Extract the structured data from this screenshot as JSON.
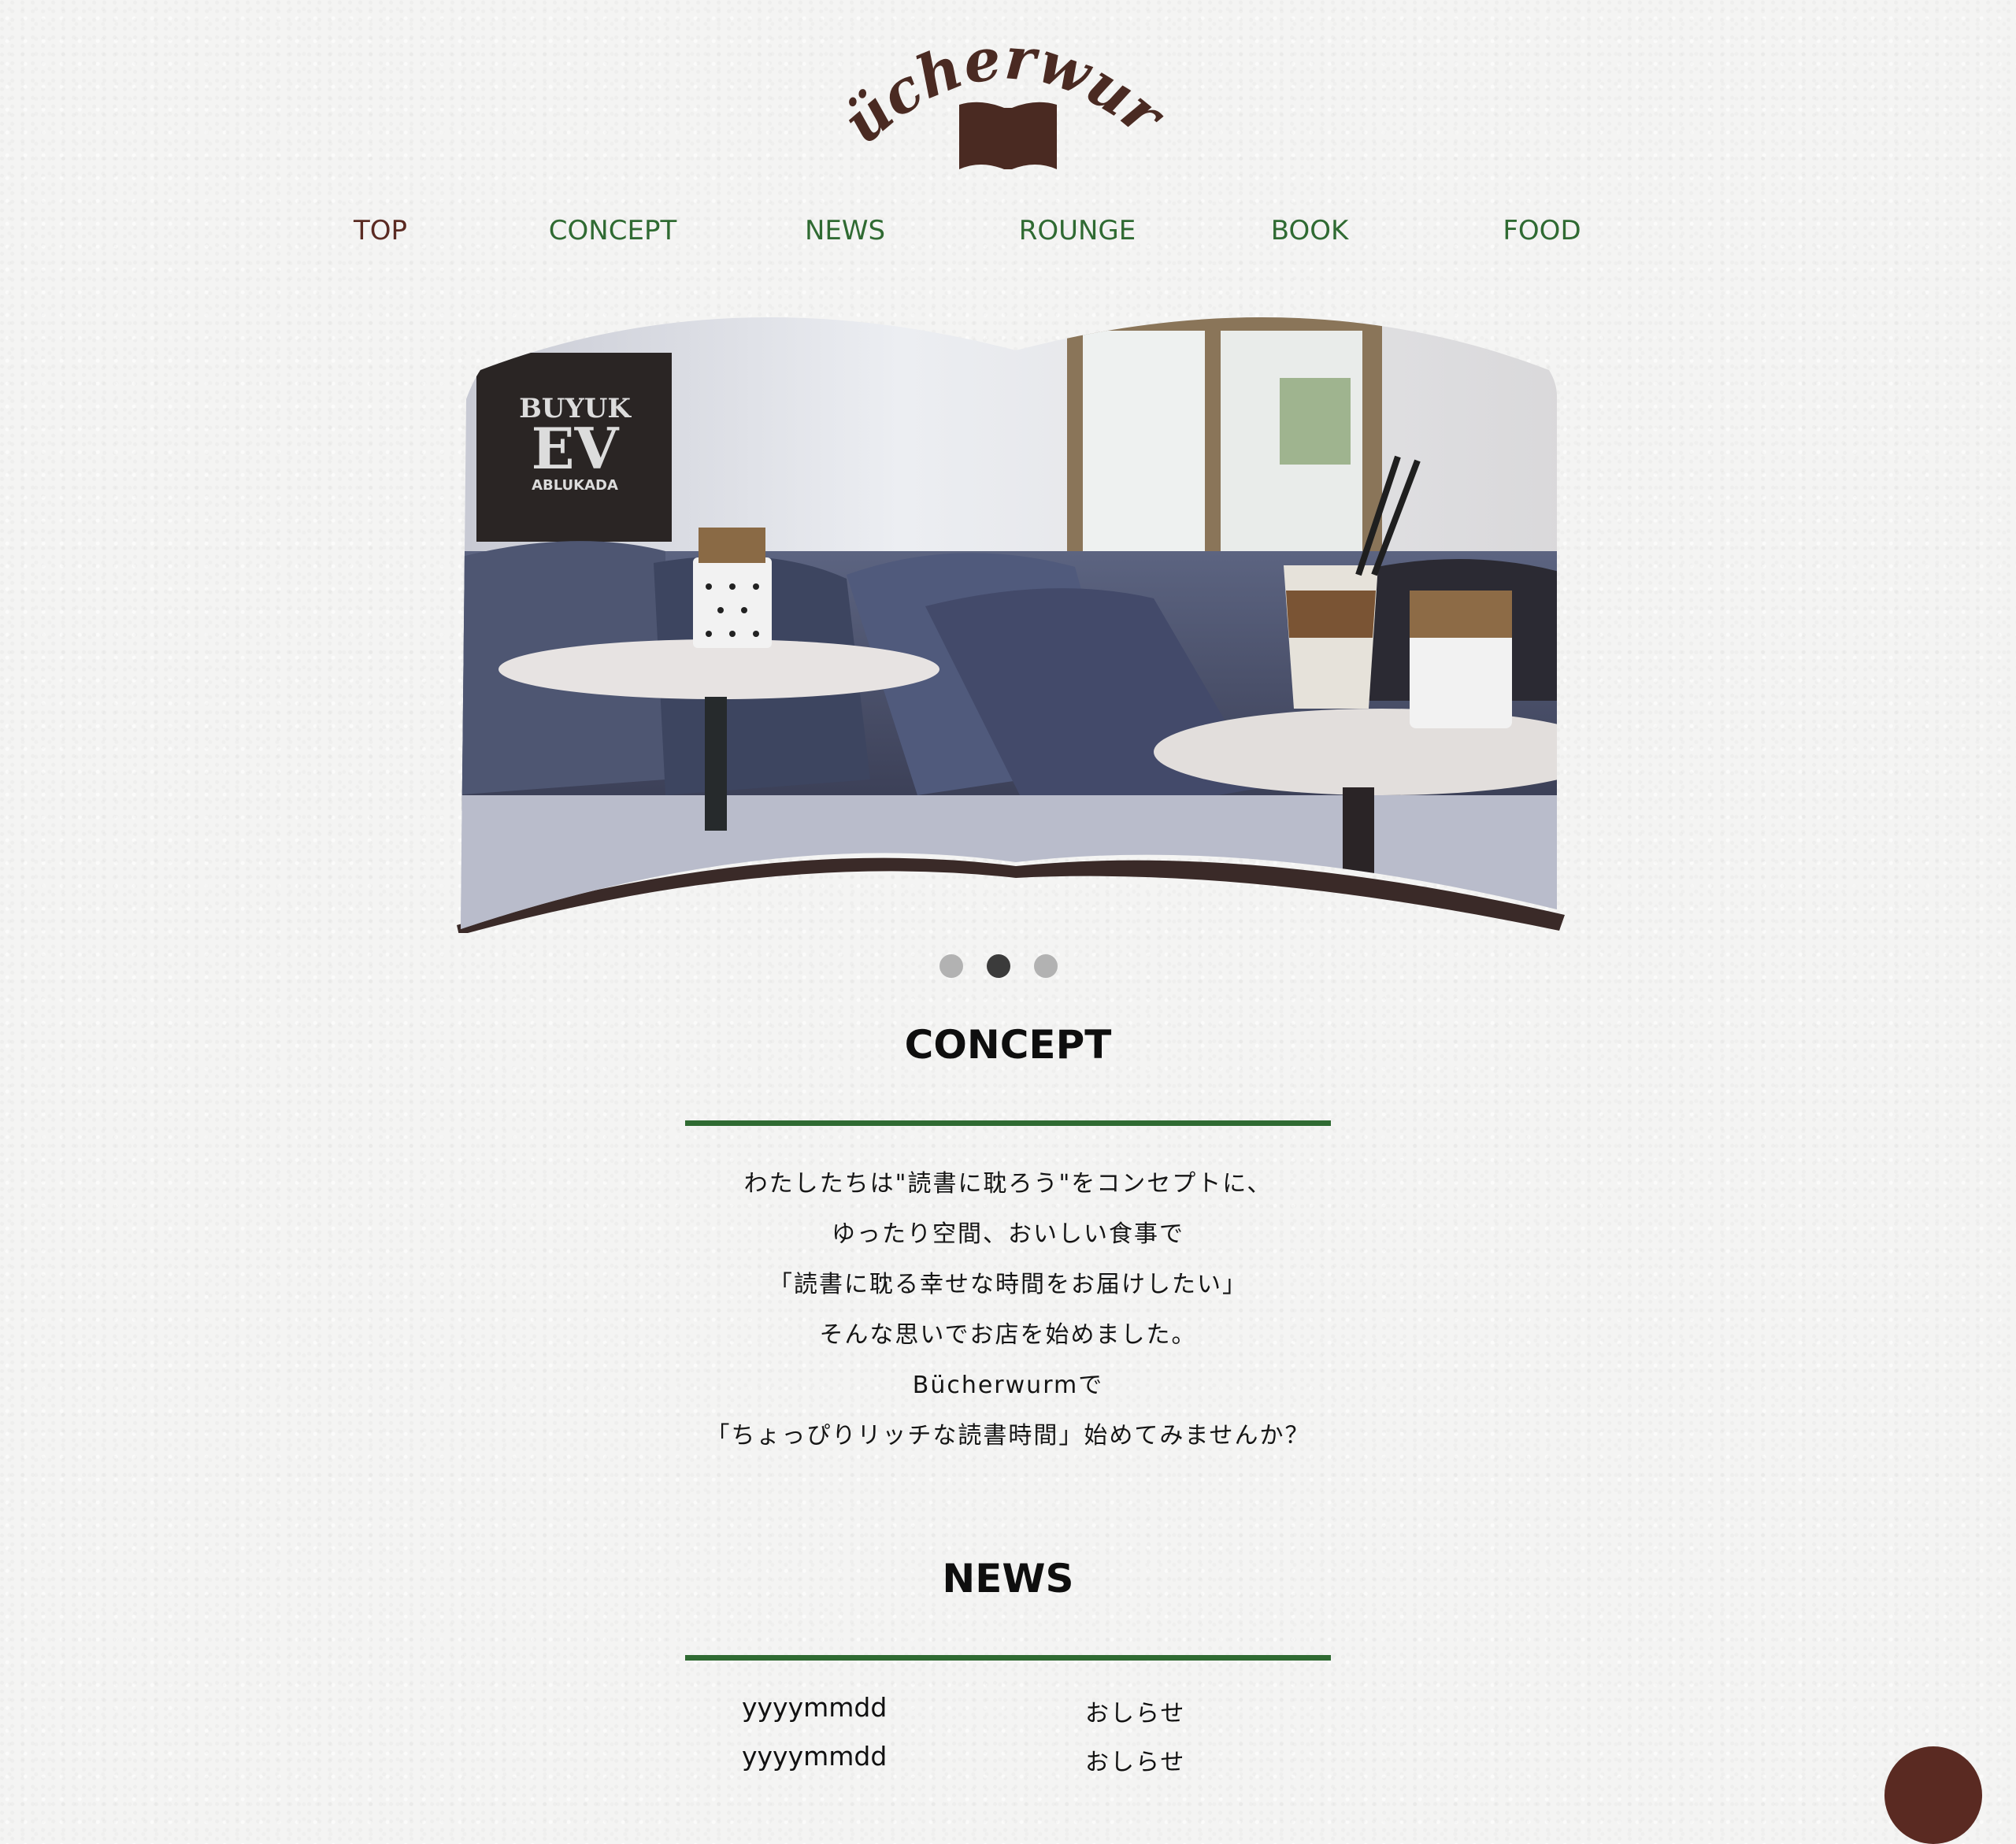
{
  "brand": {
    "logo_text": "Bücherwurm",
    "logo_color": "#4a2a22"
  },
  "nav": {
    "items": [
      {
        "label": "TOP",
        "active": true
      },
      {
        "label": "CONCEPT"
      },
      {
        "label": "NEWS"
      },
      {
        "label": "ROUNGE"
      },
      {
        "label": "BOOK"
      },
      {
        "label": "FOOD"
      }
    ],
    "active_color": "#5a2a22",
    "color": "#2f6a32"
  },
  "hero": {
    "slide_count": 3,
    "active_slide": 2,
    "poster_text": [
      "BUYUK",
      "EV",
      "ABLUKADA"
    ]
  },
  "concept": {
    "title": "CONCEPT",
    "lines": [
      "わたしたちは\"読書に耽ろう\"をコンセプトに、",
      "ゆったり空間、おいしい食事で",
      "「読書に耽る幸せな時間をお届けしたい」",
      "そんな思いでお店を始めました。",
      "Bücherwurmで",
      "「ちょっぴりリッチな読書時間」始めてみませんか？"
    ]
  },
  "news": {
    "title": "NEWS",
    "items": [
      {
        "date": "yyyymmdd",
        "text": "おしらせ"
      },
      {
        "date": "yyyymmdd",
        "text": "おしらせ"
      }
    ]
  },
  "colors": {
    "accent_green": "#2f6a32",
    "brand_brown": "#5a2a22"
  }
}
